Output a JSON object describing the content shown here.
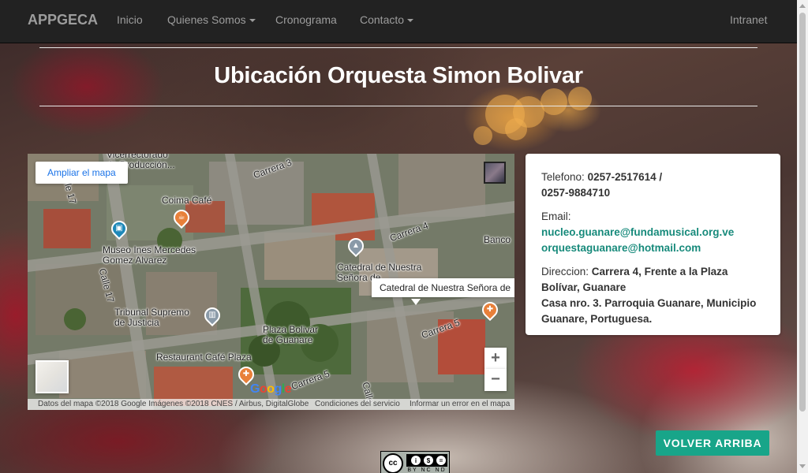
{
  "navbar": {
    "brand": "APPGECA",
    "items": [
      {
        "label": "Inicio",
        "dropdown": false
      },
      {
        "label": "Quienes Somos",
        "dropdown": true
      },
      {
        "label": "Cronograma",
        "dropdown": false
      },
      {
        "label": "Contacto",
        "dropdown": true
      }
    ],
    "right_item": "Intranet"
  },
  "page": {
    "title": "Ubicación Orquesta Simon Bolivar"
  },
  "map": {
    "enlarge_label": "Ampliar el mapa",
    "place_card": "Catedral de Nuestra Señora de",
    "zoom_in": "+",
    "zoom_out": "−",
    "logo": "Google",
    "labels": {
      "vicerrectorado_1": "Vicerrectorado",
      "vicerrectorado_2": "de Producción...",
      "coima": "Coima Café",
      "museo_1": "Museo Ines Mercedes",
      "museo_2": "Gomez Alvarez",
      "catedral_1": "Catedral de Nuestra",
      "catedral_2": "Señora de...",
      "tribunal_1": "Tribunal Supremo",
      "tribunal_2": "de Justicia",
      "plaza_1": "Plaza Bolivar",
      "plaza_2": "de Guanare",
      "restaurant": "Restaurant Café Plaza",
      "banco": "Banco"
    },
    "streets": {
      "carrera3": "Carrera 3",
      "carrera4": "Carrera 4",
      "carrera5a": "Carrera 5",
      "carrera5b": "Carrera 5",
      "calle17a": "Calle 17",
      "calle17b": "Calle 17",
      "calle_c": "Calle"
    },
    "footer": {
      "attribution": "Datos del mapa ©2018 Google Imágenes ©2018 CNES / Airbus, DigitalGlobe",
      "terms": "Condiciones del servicio",
      "report": "Informar un error en el mapa"
    }
  },
  "contact": {
    "phone_label": "Telefono:",
    "phone_value_1": "0257-2517614 /",
    "phone_value_2": "0257-9884710",
    "email_label": "Email:",
    "email_1": "nucleo.guanare@fundamusical.org.ve",
    "email_2": "orquestaguanare@hotmail.com",
    "address_label": "Direccion:",
    "address_1": "Carrera 4, Frente a la Plaza Bolívar, Guanare",
    "address_2": "Casa nro. 3. Parroquia Guanare, Municipio Guanare, Portuguesa."
  },
  "footer": {
    "back_to_top": "VOLVER ARRIBA",
    "license_badge": "cc",
    "license_terms": "BY NC ND"
  },
  "colors": {
    "navbar_bg": "#222222",
    "nav_text": "#9d9d9d",
    "accent": "#18a589",
    "link": "#178a7b"
  }
}
